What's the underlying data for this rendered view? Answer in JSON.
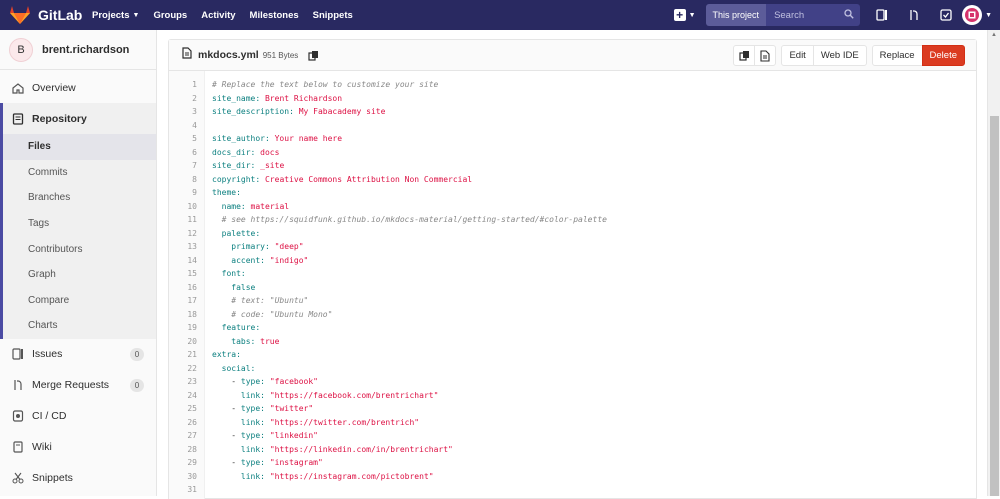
{
  "navbar": {
    "brand": "GitLab",
    "links": [
      {
        "label": "Projects",
        "has_caret": true
      },
      {
        "label": "Groups"
      },
      {
        "label": "Activity"
      },
      {
        "label": "Milestones"
      },
      {
        "label": "Snippets"
      }
    ],
    "search_scope": "This project",
    "search_placeholder": "Search"
  },
  "sidebar": {
    "avatar_letter": "B",
    "project_name": "brent.richardson",
    "overview": "Overview",
    "repository": "Repository",
    "repo_sub": [
      "Files",
      "Commits",
      "Branches",
      "Tags",
      "Contributors",
      "Graph",
      "Compare",
      "Charts"
    ],
    "issues": {
      "label": "Issues",
      "count": "0"
    },
    "merge_requests": {
      "label": "Merge Requests",
      "count": "0"
    },
    "cicd": "CI / CD",
    "wiki": "Wiki",
    "snippets": "Snippets"
  },
  "file": {
    "name": "mkdocs.yml",
    "size": "951 Bytes",
    "actions": {
      "edit": "Edit",
      "web_ide": "Web IDE",
      "replace": "Replace",
      "delete": "Delete"
    },
    "lines": [
      "# Replace the text below to customize your site",
      "site_name: Brent Richardson",
      "site_description: My Fabacademy site",
      "",
      "site_author: Your name here",
      "docs_dir: docs",
      "site_dir: _site",
      "copyright: Creative Commons Attribution Non Commercial",
      "theme:",
      "  name: material",
      "  # see https://squidfunk.github.io/mkdocs-material/getting-started/#color-palette",
      "  palette:",
      "    primary: \"deep\"",
      "    accent: \"indigo\"",
      "  font:",
      "    false",
      "    # text: \"Ubuntu\"",
      "    # code: \"Ubuntu Mono\"",
      "  feature:",
      "    tabs: true",
      "extra:",
      "  social:",
      "    - type: \"facebook\"",
      "      link: \"https://facebook.com/brentrichart\"",
      "    - type: \"twitter\"",
      "      link: \"https://twitter.com/brentrich\"",
      "    - type: \"linkedin\"",
      "      link: \"https://linkedin.com/in/brentrichart\"",
      "    - type: \"instagram\"",
      "      link: \"https://instagram.com/pictobrent\"",
      ""
    ]
  },
  "colors": {
    "navbar": "#292961",
    "accent": "#4b4ba3",
    "delete": "#db3b21"
  },
  "icons": [
    "gitlab-logo-icon",
    "plus-square-icon",
    "search-icon",
    "issues-icon",
    "merge-request-icon",
    "todo-icon",
    "user-avatar-icon",
    "file-icon",
    "copy-icon",
    "overview-icon",
    "repository-icon",
    "issues-icon",
    "merge-request-icon",
    "cicd-icon",
    "wiki-icon",
    "snippets-icon"
  ]
}
